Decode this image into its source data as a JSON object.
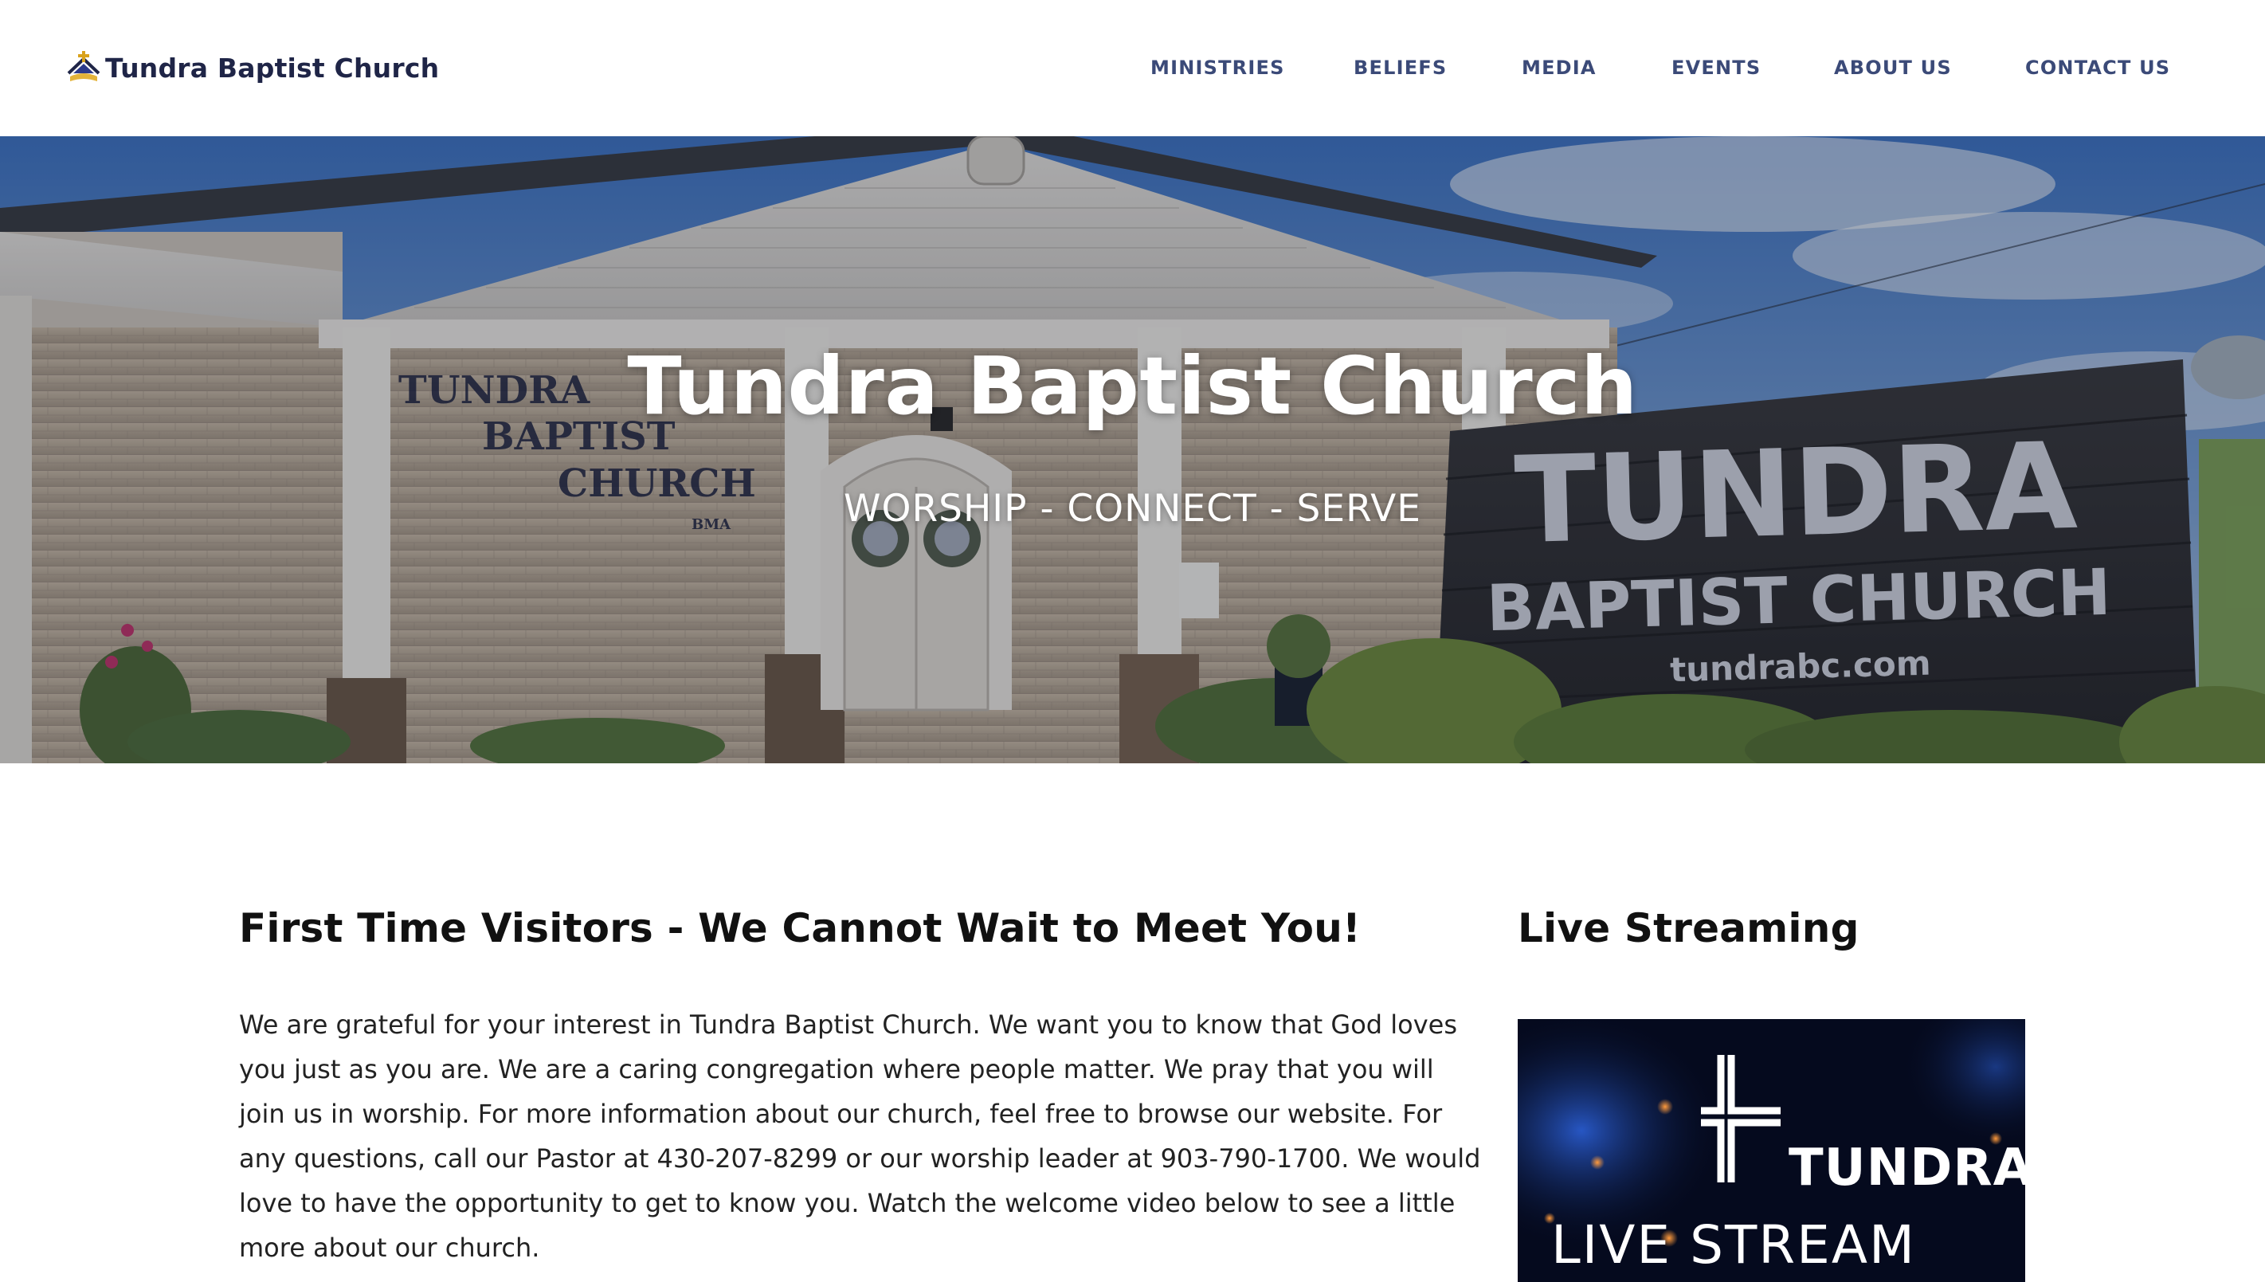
{
  "header": {
    "logo_text": "Tundra Baptist Church",
    "nav": [
      {
        "label": "MINISTRIES"
      },
      {
        "label": "BELIEFS"
      },
      {
        "label": "MEDIA"
      },
      {
        "label": "EVENTS"
      },
      {
        "label": "ABOUT US"
      },
      {
        "label": "CONTACT US"
      }
    ]
  },
  "hero": {
    "title": "Tundra Baptist Church",
    "subtitle": "WORSHIP - CONNECT - SERVE",
    "photo_signs": {
      "wall_sign": [
        "TUNDRA",
        "BAPTIST",
        "CHURCH",
        "BMA"
      ],
      "monument_sign": [
        "TUNDRA",
        "BAPTIST CHURCH",
        "tundrabc.com"
      ]
    }
  },
  "visitors": {
    "heading": "First Time Visitors - We Cannot Wait to Meet You!",
    "body": "We are grateful for your interest in Tundra Baptist Church. We want you to know that God loves you just as you are. We are a caring congregation where people matter. We pray that you will join us in worship. For more information about our church, feel free to browse our website. For any questions, call our Pastor at 430-207-8299 or our worship leader at 903-790-1700. We would love to have the opportunity to get to know you. Watch the welcome video below to see a little more about our church."
  },
  "live_stream": {
    "heading": "Live Streaming",
    "thumb_line1": "TUNDRA",
    "thumb_line2": "LIVE STREAM"
  },
  "colors": {
    "nav_text": "#3b4a78",
    "logo_text": "#1f2547",
    "heading_text": "#111111",
    "body_text": "#222222"
  }
}
